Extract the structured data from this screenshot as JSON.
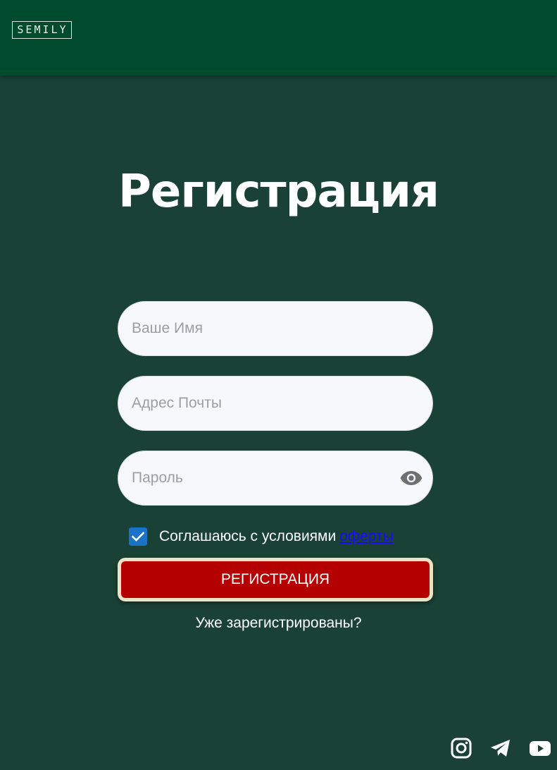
{
  "header": {
    "logo_text": "SEMILY"
  },
  "main": {
    "title": "Регистрация",
    "fields": {
      "name_placeholder": "Ваше Имя",
      "email_placeholder": "Адрес Почты",
      "password_placeholder": "Пароль"
    },
    "agree": {
      "checked": true,
      "text": "Соглашаюсь с условиями",
      "link": "оферты"
    },
    "register_button": "РЕГИСТРАЦИЯ",
    "login_link": "Уже зарегистрированы?"
  },
  "footer": {
    "social_icons": [
      "instagram-icon",
      "telegram-icon",
      "youtube-icon"
    ]
  },
  "colors": {
    "background": "#1a4136",
    "header": "#004a2d",
    "button": "#b40000",
    "button_border": "#ece2c6",
    "checkbox": "#1a73c9",
    "link": "#1a0dff"
  }
}
